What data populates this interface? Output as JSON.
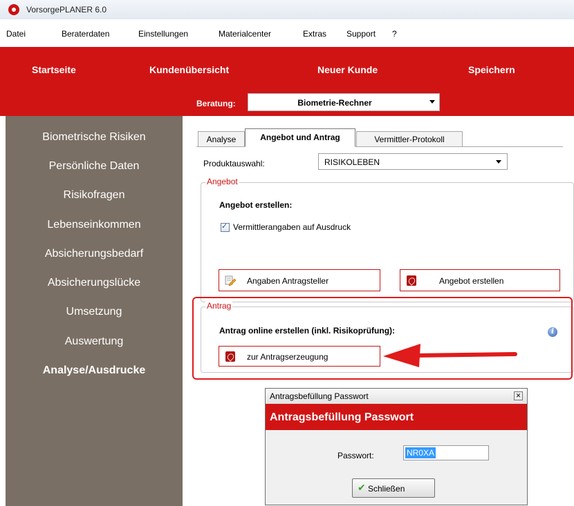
{
  "window": {
    "title": "VorsorgePLANER 6.0"
  },
  "menu": [
    "Datei",
    "Beraterdaten",
    "Einstellungen",
    "Materialcenter",
    "Extras",
    "Support",
    "?"
  ],
  "toolbar": {
    "nav": [
      "Startseite",
      "Kundenübersicht",
      "Neuer Kunde",
      "Speichern"
    ],
    "beratung_label": "Beratung:",
    "beratung_value": "Biometrie-Rechner"
  },
  "sidebar": {
    "items": [
      "Biometrische Risiken",
      "Persönliche Daten",
      "Risikofragen",
      "Lebenseinkommen",
      "Absicherungsbedarf",
      "Absicherungslücke",
      "Umsetzung",
      "Auswertung",
      "Analyse/Ausdrucke"
    ],
    "active_index": 8
  },
  "tabs": [
    "Analyse",
    "Angebot und Antrag",
    "Vermittler-Protokoll"
  ],
  "produkt": {
    "label": "Produktauswahl:",
    "value": "RISIKOLEBEN"
  },
  "angebot": {
    "legend": "Angebot",
    "heading": "Angebot erstellen:",
    "checkbox_label": "Vermittlerangaben auf Ausdruck",
    "checkbox_checked": true,
    "btn_antragsteller": "Angaben Antragsteller",
    "btn_angebot": "Angebot erstellen"
  },
  "antrag": {
    "legend": "Antrag",
    "heading": "Antrag online erstellen (inkl. Risikoprüfung):",
    "btn_antrag": "zur Antragserzeugung"
  },
  "dialog": {
    "title": "Antragsbefüllung Passwort",
    "header": "Antragsbefüllung Passwort",
    "password_label": "Passwort:",
    "password_value": "NR0XA",
    "close_label": "Schließen"
  },
  "colors": {
    "accent_red": "#d01414",
    "sidebar": "#7a6f64"
  }
}
